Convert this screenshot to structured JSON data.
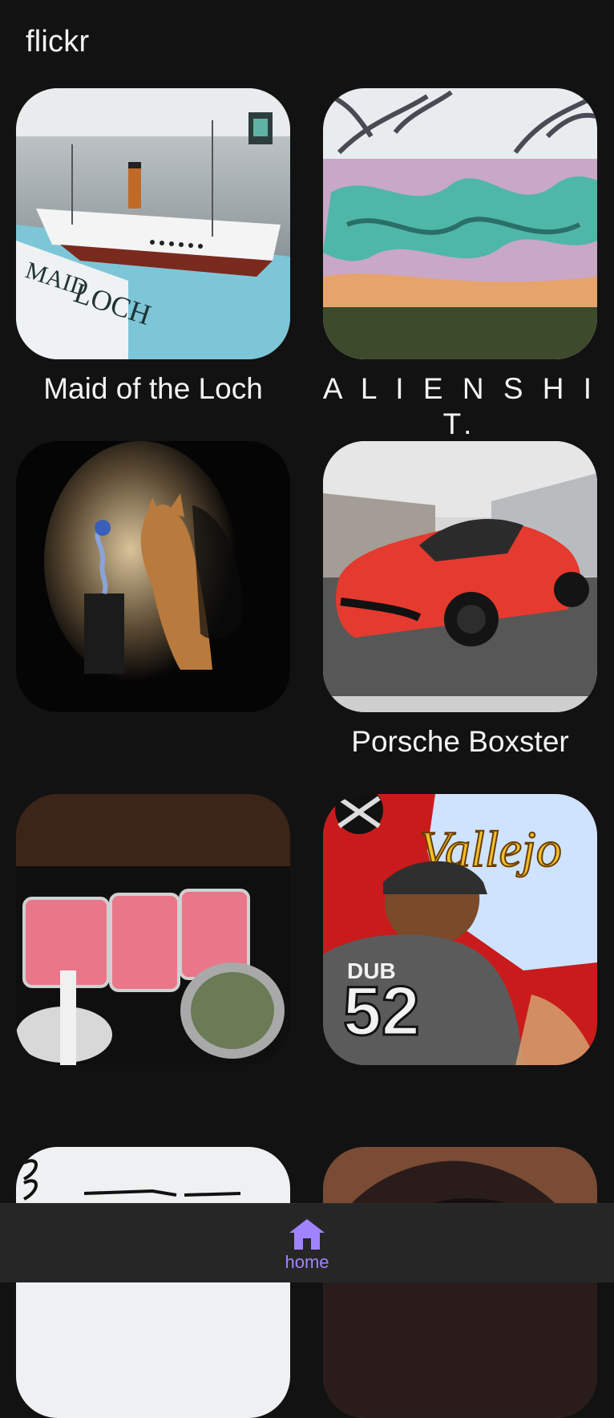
{
  "app": {
    "title": "flickr"
  },
  "feed": {
    "items": [
      {
        "caption": "Maid of the Loch",
        "image": "ship-model-photo"
      },
      {
        "caption": "A L I E N S H I T.",
        "image": "graffiti-wall-photo"
      },
      {
        "caption": "",
        "image": "cat-silhouette-photo"
      },
      {
        "caption": "Porsche Boxster",
        "image": "red-porsche-photo"
      },
      {
        "caption": "",
        "image": "raw-meat-buffet-photo"
      },
      {
        "caption": "",
        "image": "baseball-player-illustration"
      },
      {
        "caption": "",
        "image": "sketchbook-photo"
      },
      {
        "caption": "",
        "image": "portrait-photo"
      }
    ]
  },
  "nav": {
    "home_label": "home",
    "home_icon": "home-icon",
    "accent_color": "#a084ff"
  }
}
